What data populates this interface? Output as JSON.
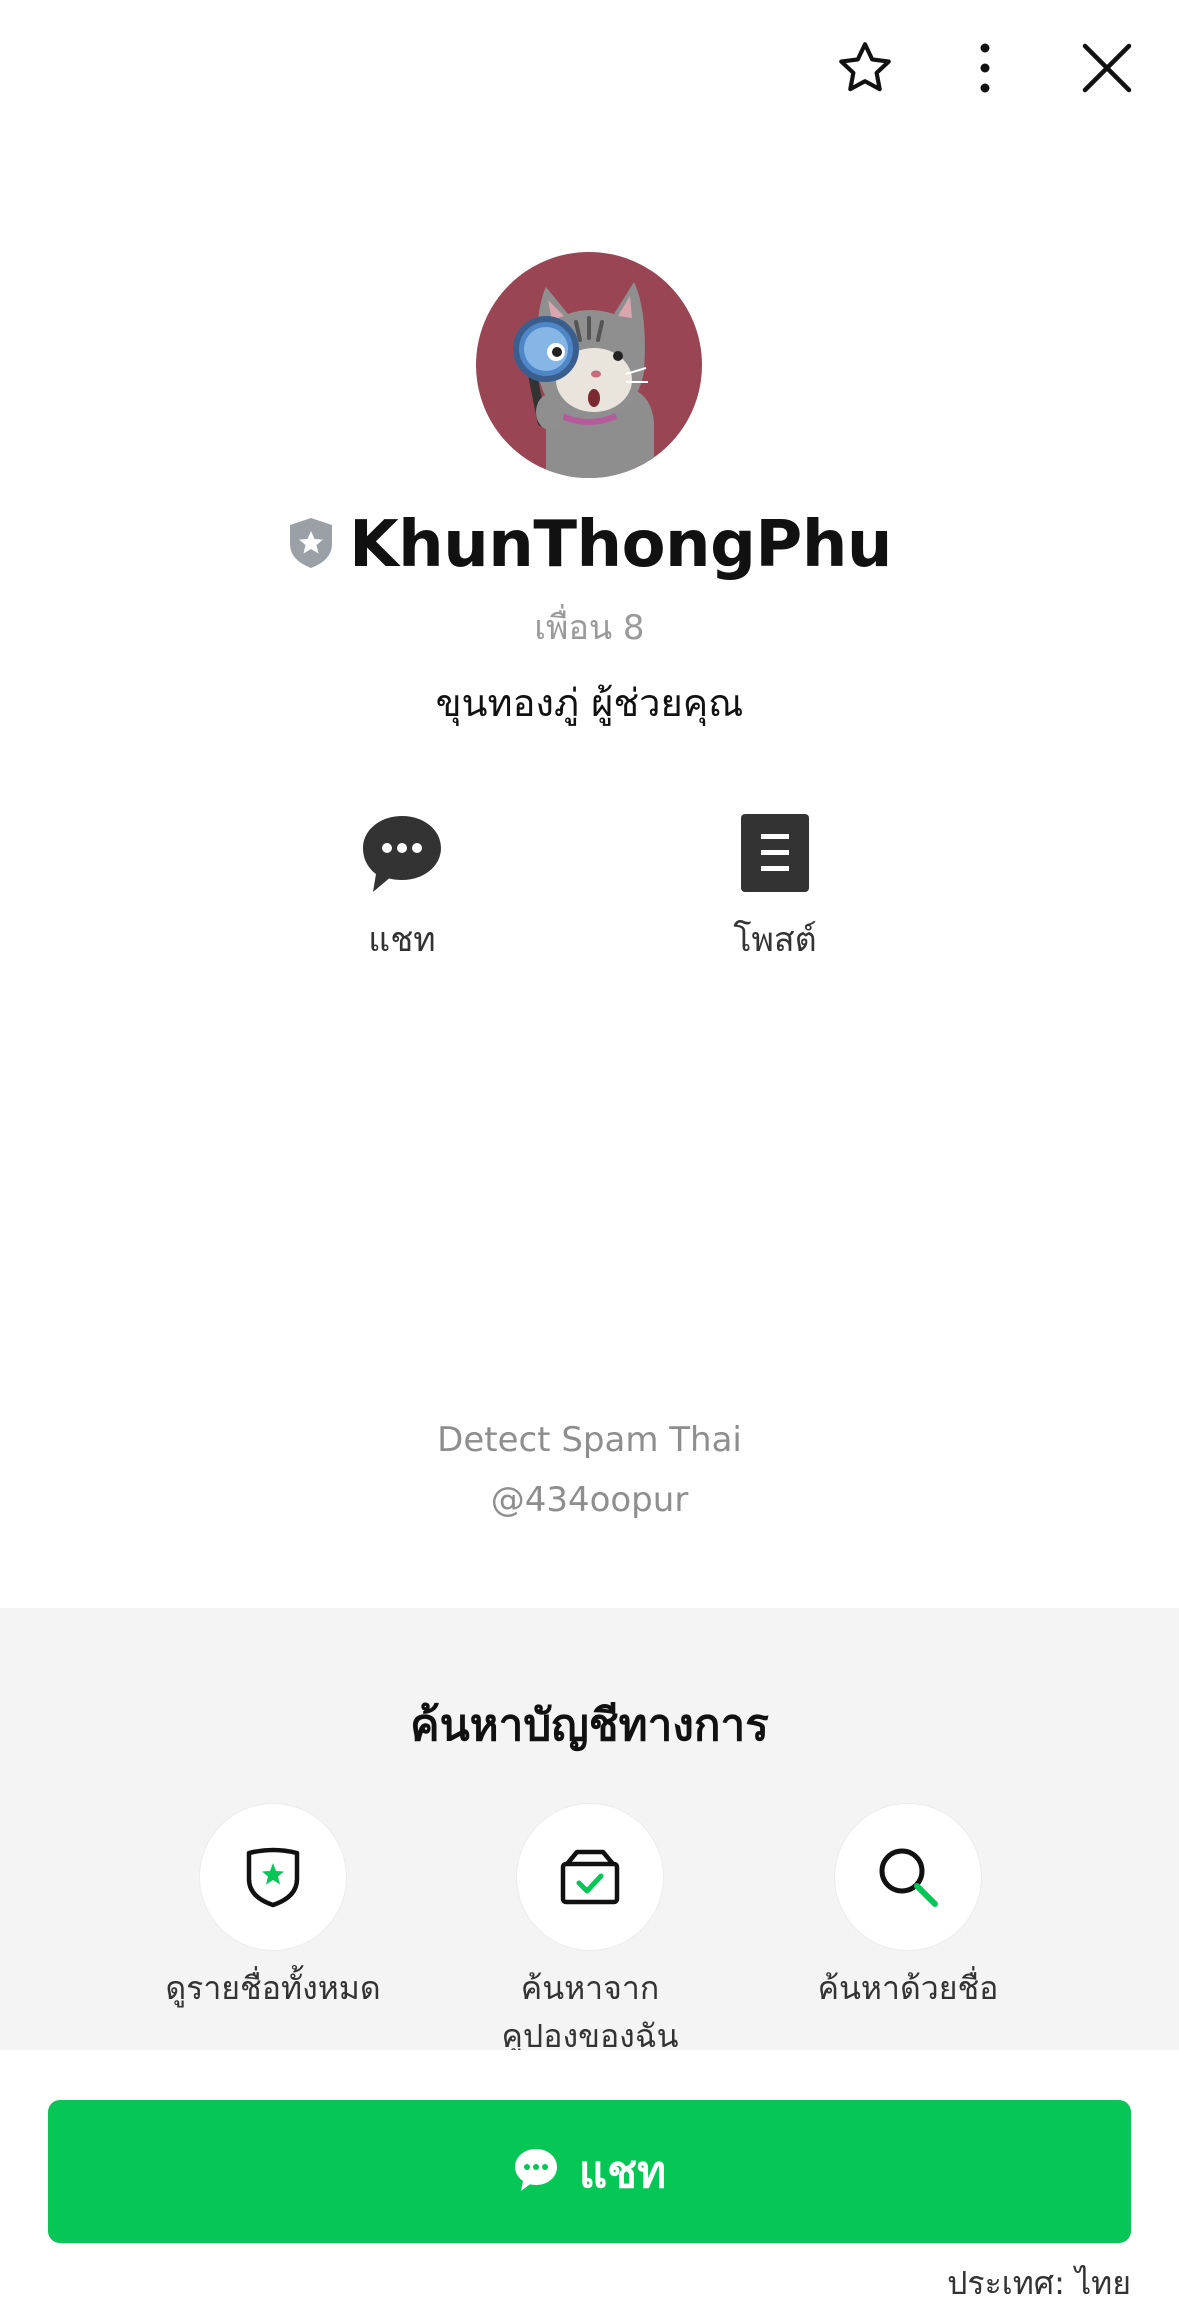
{
  "profile": {
    "name": "KhunThongPhu",
    "friends": "เพื่อน 8",
    "status_message": "ขุนทองภู่ ผู้ช่วยคุณ"
  },
  "actions": [
    {
      "label": "แชท",
      "icon": "chat-bubble-icon"
    },
    {
      "label": "โพสต์",
      "icon": "document-icon"
    }
  ],
  "footer": {
    "line1": "Detect Spam Thai",
    "line2": "@434oopur"
  },
  "search_section": {
    "title": "ค้นหาบัญชีทางการ",
    "items": [
      {
        "label": "ดูรายชื่อทั้งหมด",
        "icon": "shield-star-icon"
      },
      {
        "label": "ค้นหาจาก คูปองของฉัน",
        "icon": "coupon-box-icon"
      },
      {
        "label": "ค้นหาด้วยชื่อ",
        "icon": "search-icon"
      }
    ]
  },
  "chat_button": {
    "label": "แชท"
  },
  "country": "ประเทศ: ไทย",
  "colors": {
    "accent": "#06c755",
    "avatar_bg": "#9a4553",
    "badge": "#9aa0a6"
  }
}
